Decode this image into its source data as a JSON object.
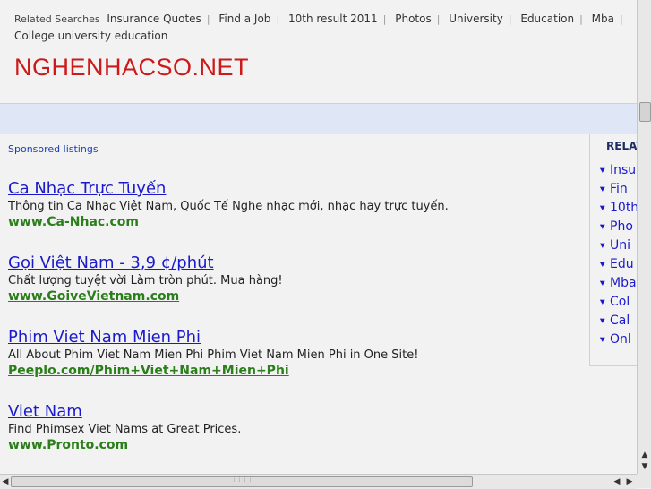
{
  "related_searches": {
    "label": "Related Searches",
    "items": [
      "Insurance Quotes",
      "Find a Job",
      "10th result 2011",
      "Photos",
      "University",
      "Education",
      "Mba",
      "College university",
      "education"
    ]
  },
  "site_title": "NGHENHACSO.NET",
  "sponsored_label": "Sponsored listings",
  "ads": [
    {
      "title": "Ca Nhạc Trực Tuyến",
      "desc": "Thông tin Ca Nhạc Việt Nam, Quốc Tế Nghe nhạc mới, nhạc hay trực tuyến.",
      "url": "www.Ca-Nhac.com"
    },
    {
      "title": "Gọi Việt Nam - 3,9 ¢/phút",
      "desc": "Chất lượng tuyệt vời Làm tròn phút. Mua hàng!",
      "url": "www.GoiveVietnam.com"
    },
    {
      "title": "Phim Viet Nam Mien Phi",
      "desc": "All About Phim Viet Nam Mien Phi Phim Viet Nam Mien Phi in One Site!",
      "url": "Peeplo.com/Phim+Viet+Nam+Mien+Phi"
    },
    {
      "title": "Viet Nam",
      "desc": "Find Phimsex Viet Nams at Great Prices.",
      "url": "www.Pronto.com"
    }
  ],
  "sidebar": {
    "heading": "RELAT",
    "items": [
      "Insu",
      "Fin",
      "10th",
      "Pho",
      "Uni",
      "Edu",
      "Mba",
      "Col",
      "Cal",
      "Onl"
    ]
  },
  "scrollbar_icons": [
    "arrow-up-icon",
    "arrow-down-icon",
    "arrow-left-icon",
    "arrow-right-icon"
  ]
}
